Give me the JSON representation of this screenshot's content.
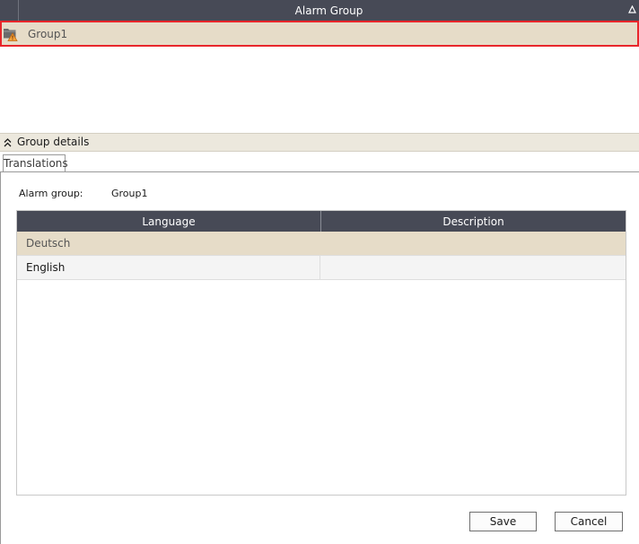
{
  "alarm_group_grid": {
    "header": "Alarm Group",
    "sort_icon": "sort-triangle-icon",
    "rows": [
      {
        "label": "Group1",
        "icon": "alarm-folder-warning-icon",
        "selected": true
      }
    ],
    "selection_border_color": "#e8262b",
    "selected_row_color": "#e6dcc8"
  },
  "details": {
    "title": "Group details",
    "collapse_icon": "double-chevron-up-icon",
    "tabs": [
      {
        "label": "Translations",
        "active": true
      }
    ],
    "alarm_group_label": "Alarm group:",
    "alarm_group_value": "Group1",
    "table": {
      "columns": [
        "Language",
        "Description"
      ],
      "rows": [
        {
          "language": "Deutsch",
          "description": "",
          "selected": true
        },
        {
          "language": "English",
          "description": "",
          "selected": false
        }
      ]
    },
    "buttons": {
      "save": "Save",
      "cancel": "Cancel"
    }
  },
  "colors": {
    "header_bg": "#474a56",
    "header_text": "#ffffff"
  }
}
